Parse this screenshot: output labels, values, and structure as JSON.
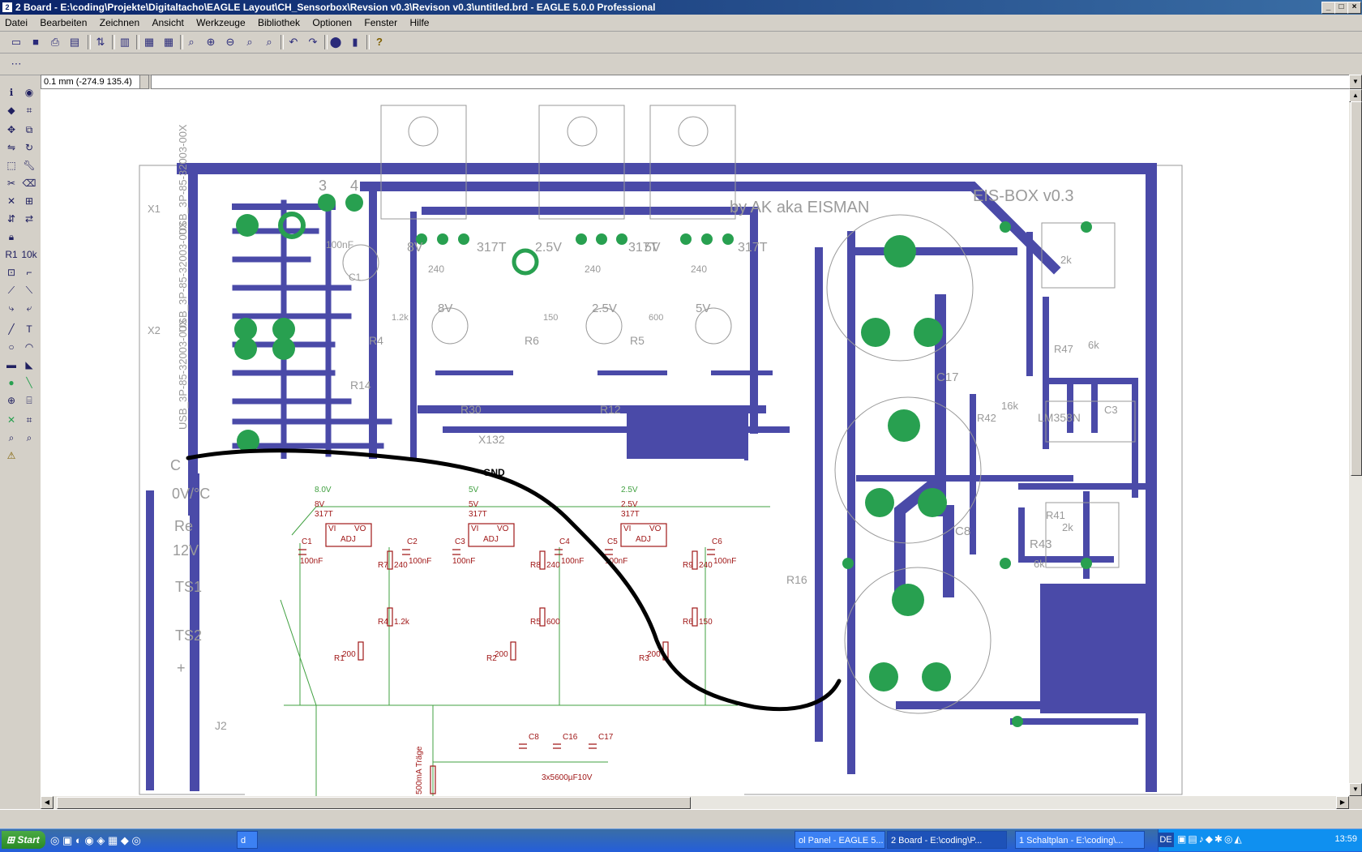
{
  "window": {
    "title": "2 Board - E:\\coding\\Projekte\\Digitaltacho\\EAGLE Layout\\CH_Sensorbox\\Revsion  v0.3\\Revison v0.3\\untitled.brd - EAGLE 5.0.0 Professional",
    "icon_glyph": "2"
  },
  "menu": [
    "Datei",
    "Bearbeiten",
    "Zeichnen",
    "Ansicht",
    "Werkzeuge",
    "Bibliothek",
    "Optionen",
    "Fenster",
    "Hilfe"
  ],
  "coord_readout": "0.1 mm (-274.9 135.4)",
  "command_line": "",
  "board": {
    "title_mirror": "EIS-BOX v0.3",
    "author_mirror": "by AK aka EISMAN",
    "connector_names": [
      "USB_3P-85-32003-00X",
      "USB_3P-85-32003-00X",
      "USB_3P-85-32003-00X"
    ],
    "labels": {
      "v8": "8V",
      "v25": "2.5V",
      "v5": "5V",
      "t317a": "317T",
      "t317b": "317T",
      "t317c": "317T",
      "n3": "3",
      "n4": "4",
      "c100": "100nF",
      "c1": "C1",
      "r4": "R4",
      "r6": "R6",
      "r5": "R5",
      "r30": "R30",
      "r12": "R12",
      "r14": "R14",
      "lm": "LM358N",
      "c17": "C17",
      "c8": "C8",
      "r43": "R43",
      "r43v": "6k",
      "r47": "R47",
      "r47v": "6k",
      "r44": "2k",
      "r41": "R41",
      "r41v": "2k",
      "r42": "R42",
      "r42v": "16k",
      "c3": "C3",
      "r16": "R16",
      "x132": "X132",
      "v240a": "240",
      "v240b": "240",
      "v240c": "240",
      "v1k2": "1.2k",
      "v150": "150",
      "v600": "600",
      "v8b": "8V",
      "v25b": "2.5V",
      "v5b": "5V",
      "x1": "X1",
      "x2": "X2",
      "j2": "J2",
      "l0v": "0V/°C",
      "lre": "Re",
      "l12": "12V",
      "lts1": "TS1",
      "lts2": "TS2",
      "lp": "+",
      "lc": "C"
    }
  },
  "schematic": {
    "gnd": "GND",
    "rails": [
      "8.0V",
      "5V",
      "2.5V"
    ],
    "regs": [
      {
        "name": "8V",
        "type": "317T",
        "vi": "VI",
        "vo": "VO",
        "adj": "ADJ",
        "cin": "C1",
        "cin_v": "100nF",
        "r1": "R7",
        "r1v": "240",
        "cout": "C2",
        "cout_v": "100nF",
        "r2": "R4",
        "r2v": "1.2k",
        "pot": "R1",
        "potv": "200"
      },
      {
        "name": "5V",
        "type": "317T",
        "vi": "VI",
        "vo": "VO",
        "adj": "ADJ",
        "cin": "C3",
        "cin_v": "100nF",
        "r1": "R8",
        "r1v": "240",
        "cout": "C4",
        "cout_v": "100nF",
        "r2": "R5",
        "r2v": "600",
        "pot": "R2",
        "potv": "200"
      },
      {
        "name": "2.5V",
        "type": "317T",
        "vi": "VI",
        "vo": "VO",
        "adj": "ADJ",
        "cin": "C5",
        "cin_v": "100nF",
        "r1": "R9",
        "r1v": "240",
        "cout": "C6",
        "cout_v": "100nF",
        "r2": "R6",
        "r2v": "150",
        "pot": "R3",
        "potv": "200"
      }
    ],
    "caps": [
      "C8",
      "C16",
      "C17"
    ],
    "caps_note": "3x5600µF10V",
    "fuse": "500mA Träge"
  },
  "taskbar": {
    "start": "Start",
    "tasks": [
      {
        "label": "d",
        "active": false
      },
      {
        "label": "ol Panel - EAGLE 5...",
        "active": false
      },
      {
        "label": "2 Board - E:\\coding\\P...",
        "active": true
      },
      {
        "label": "1 Schaltplan - E:\\coding\\...",
        "active": false
      }
    ],
    "lang": "DE",
    "clock": "13:59"
  },
  "colors": {
    "copper": "#4a4aa8",
    "pad": "#28a050",
    "silk": "#9a9a9a",
    "schem": "#a01818",
    "net": "#40a040"
  }
}
